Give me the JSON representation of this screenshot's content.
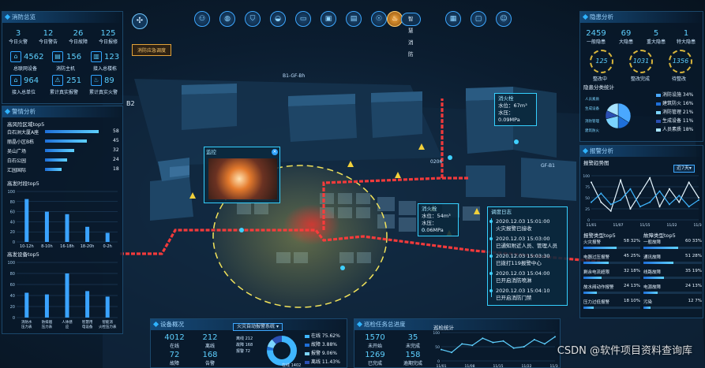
{
  "toolbar": {
    "active_label": "智慧消防",
    "emergency_button": "消防应急调度"
  },
  "fire_overview": {
    "title": "消防总览",
    "stats": [
      {
        "value": "3",
        "label": "今日火警"
      },
      {
        "value": "12",
        "label": "今日警告"
      },
      {
        "value": "26",
        "label": "今日故障"
      },
      {
        "value": "125",
        "label": "今日报修"
      }
    ],
    "items": [
      {
        "value": "4562",
        "label": "总联网设备"
      },
      {
        "value": "156",
        "label": "消防主机"
      },
      {
        "value": "123",
        "label": "接入总楼栋"
      },
      {
        "value": "964",
        "label": "接入总单位"
      },
      {
        "value": "251",
        "label": "累计真实报警"
      },
      {
        "value": "89",
        "label": "累计真实火警"
      }
    ]
  },
  "alarm_analysis": {
    "title": "警情分析",
    "top5_title": "高风险区域top5",
    "top5": [
      {
        "name": "白石洲大厦A座",
        "value": 58
      },
      {
        "name": "丽晶小区B栋",
        "value": 45
      },
      {
        "name": "吴山广场",
        "value": 32
      },
      {
        "name": "白石公园",
        "value": 24
      },
      {
        "name": "汇园国际",
        "value": 18
      }
    ],
    "time_title": "高发时段top5",
    "time_chart": {
      "type": "bar",
      "categories": [
        "10-12h",
        "8-10h",
        "16-18h",
        "18-20h",
        "0-2h"
      ],
      "values": [
        85,
        60,
        55,
        30,
        18
      ],
      "ylim": [
        0,
        100
      ],
      "ticks": [
        0,
        20,
        40,
        60,
        80,
        100
      ]
    },
    "device_title": "高发设备top5",
    "device_chart": {
      "type": "bar",
      "categories": [
        "消防水压力表",
        "防排烟压力表",
        "人体感应",
        "智慧用电设备",
        "智能消火栓压力表"
      ],
      "values": [
        45,
        42,
        80,
        48,
        38
      ],
      "ylim": [
        0,
        100
      ],
      "ticks": [
        0,
        20,
        40,
        60,
        80,
        100
      ]
    }
  },
  "map": {
    "building_label": "B2",
    "road_label_1": "B1-GF-Bh",
    "road_label_2": "GF-B1",
    "marker_label": "0206",
    "monitor_title": "监控",
    "hydrant1": {
      "title": "消火栓",
      "level": "水位：67m³",
      "pressure": "水压：0.09MPa"
    },
    "hydrant2": {
      "title": "消火栓",
      "level": "水位：54m³",
      "pressure": "水压：0.06MPa"
    },
    "events": {
      "title": "调度日志",
      "items": [
        {
          "time": "2020.12.03 15:01:00",
          "text": "火灾报警已接收"
        },
        {
          "time": "2020.12.03 15:03:00",
          "text": "已通知附近人员、管理人员"
        },
        {
          "time": "2020.12.03 15:03:30",
          "text": "已拨打119报警中心"
        },
        {
          "time": "2020.12.03 15:04:00",
          "text": "已开启消防喷淋"
        },
        {
          "time": "2020.12.03 15:04:10",
          "text": "已开启消防门禁"
        }
      ]
    }
  },
  "hazard_analysis": {
    "title": "隐患分析",
    "stats": [
      {
        "value": "2459",
        "label": "一般隐患"
      },
      {
        "value": "69",
        "label": "大隐患"
      },
      {
        "value": "5",
        "label": "重大隐患"
      },
      {
        "value": "1",
        "label": "特大隐患"
      }
    ],
    "gauges": [
      {
        "value": "125",
        "label": "整改中"
      },
      {
        "value": "1031",
        "label": "整改完成"
      },
      {
        "value": "1356",
        "label": "待整改"
      }
    ],
    "pie_title": "隐患分类统计",
    "pie_chart": {
      "type": "pie",
      "labels": [
        "消防设施",
        "建筑防火",
        "消防管理",
        "生成设备",
        "人员素质"
      ],
      "values": [
        34,
        16,
        21,
        11,
        18
      ],
      "percent_labels": [
        "34%",
        "16%",
        "21%",
        "11%",
        "18%"
      ],
      "colors": [
        "#4aa8ff",
        "#1e6fd9",
        "#7bd4ff",
        "#2b4fb3",
        "#a7e3ff"
      ]
    },
    "pie_callouts": [
      "人员素质",
      "生成设备",
      "消防管理",
      "建筑防火"
    ]
  },
  "alarm_trend": {
    "title": "报警分析",
    "chart_title": "报警趋势图",
    "range": "近7天",
    "chart": {
      "type": "line",
      "x": [
        "11/01",
        "11/07",
        "11/15",
        "11/22",
        "11/30"
      ],
      "y_ticks": [
        0,
        25,
        50,
        75,
        100
      ],
      "series": [
        {
          "values": [
            85,
            40,
            20,
            90,
            25,
            60,
            95,
            30,
            70,
            40,
            85,
            50
          ]
        },
        {
          "values": [
            40,
            60,
            35,
            45,
            70,
            30,
            40,
            65,
            35,
            55,
            30,
            45
          ]
        }
      ]
    },
    "type_title": "报警类型top5",
    "types": [
      {
        "name": "火灾报警",
        "value": "58 32%",
        "pct": 58
      },
      {
        "name": "电器过压报警",
        "value": "45 25%",
        "pct": 45
      },
      {
        "name": "剩余电流超限",
        "value": "32 18%",
        "pct": 32
      },
      {
        "name": "故水阀动作报警",
        "value": "24 13%",
        "pct": 24
      },
      {
        "name": "压力过低报警",
        "value": "18 10%",
        "pct": 18
      }
    ],
    "fault_title": "故障类型top5",
    "faults": [
      {
        "name": "一般故障",
        "value": "60 33%",
        "pct": 60
      },
      {
        "name": "通讯故障",
        "value": "51 28%",
        "pct": 51
      },
      {
        "name": "线路故障",
        "value": "35 19%",
        "pct": 35
      },
      {
        "name": "电源故障",
        "value": "24 13%",
        "pct": 24
      },
      {
        "name": "污染",
        "value": "12 7%",
        "pct": 12
      }
    ]
  },
  "device_overview": {
    "title": "设备概况",
    "stats": [
      {
        "value": "4012",
        "label": "在线"
      },
      {
        "value": "212",
        "label": "离线"
      },
      {
        "value": "72",
        "label": "故障"
      },
      {
        "value": "168",
        "label": "告警"
      }
    ],
    "select_label": "火灾自动报警系统",
    "donut_labels": [
      "离线 212",
      "故障 168",
      "报警 72",
      "在线 1402"
    ],
    "legend": [
      {
        "name": "在线",
        "value": "75.62%"
      },
      {
        "name": "故障",
        "value": "3.88%"
      },
      {
        "name": "报警",
        "value": "9.06%"
      },
      {
        "name": "离线",
        "value": "11.43%"
      }
    ]
  },
  "inspection": {
    "title": "巡检任务总进度",
    "stats": [
      {
        "value": "1570",
        "label": "未开始"
      },
      {
        "value": "35",
        "label": "未完成"
      },
      {
        "value": "1269",
        "label": "已完成"
      },
      {
        "value": "158",
        "label": "逾期完成"
      }
    ],
    "chart_title": "巡检统计",
    "chart": {
      "type": "line",
      "x": [
        "11/01",
        "11/08",
        "11/15",
        "11/22",
        "11/30"
      ],
      "y_ticks": [
        0,
        50,
        100
      ],
      "values": [
        40,
        30,
        60,
        55,
        80,
        65,
        70,
        45,
        50,
        75,
        60,
        85
      ]
    }
  },
  "watermark": "CSDN @软件项目资料查询库"
}
